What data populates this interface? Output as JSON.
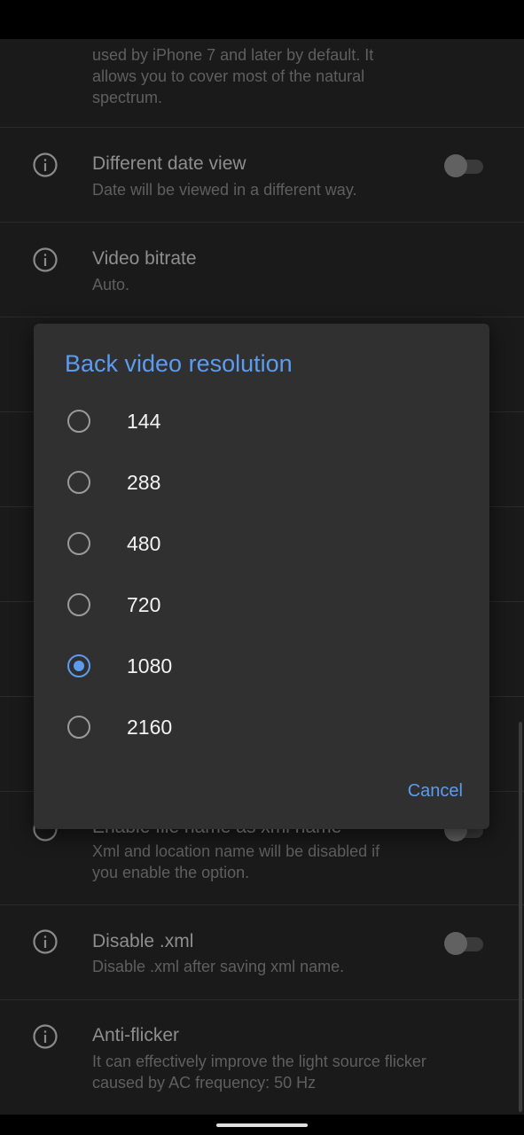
{
  "settings": {
    "top_partial": {
      "sub": "used by iPhone 7 and later by default.  It\nallows you to cover most of the natural\nspectrum."
    },
    "different_date": {
      "title": "Different date view",
      "sub": "Date will be viewed in a different way."
    },
    "video_bitrate": {
      "title": "Video bitrate",
      "sub": "Auto."
    },
    "file_name": {
      "title": "Enable file name as xml name",
      "sub": "Xml and location name will be disabled if\nyou enable the option."
    },
    "disable_xml": {
      "title": "Disable .xml",
      "sub": "Disable .xml after saving xml name."
    },
    "anti_flicker": {
      "title": "Anti-flicker",
      "sub": "It can effectively improve the light source flicker\ncaused by AC frequency: 50 Hz"
    }
  },
  "dialog": {
    "title": "Back video resolution",
    "options": [
      "144",
      "288",
      "480",
      "720",
      "1080",
      "2160"
    ],
    "selected": "1080",
    "cancel_label": "Cancel"
  },
  "colors": {
    "accent": "#5b9cf0",
    "background": "#1a1a1a",
    "dialog": "#303030"
  },
  "icons": [
    "info-icon",
    "radio-button-icon"
  ]
}
